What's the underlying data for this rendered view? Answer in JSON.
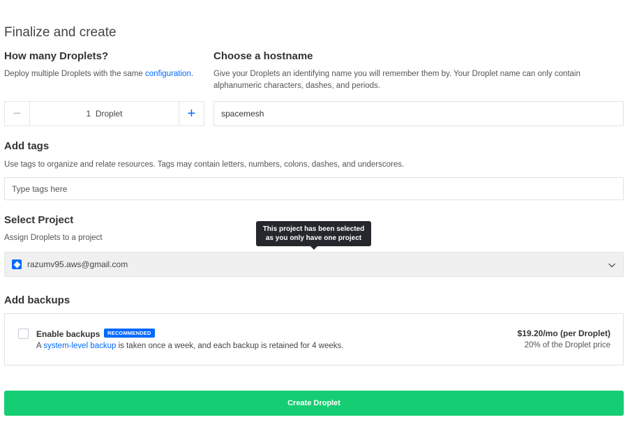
{
  "page": {
    "title": "Finalize and create"
  },
  "droplets": {
    "heading": "How many Droplets?",
    "desc_prefix": "Deploy multiple Droplets with the same ",
    "desc_link": "configuration",
    "desc_suffix": ".",
    "minus_symbol": "−",
    "plus_symbol": "+",
    "count_label": "1  Droplet"
  },
  "hostname": {
    "heading": "Choose a hostname",
    "desc": "Give your Droplets an identifying name you will remember them by. Your Droplet name can only contain alphanumeric characters, dashes, and periods.",
    "value": "spacemesh"
  },
  "tags": {
    "heading": "Add tags",
    "desc": "Use tags to organize and relate resources. Tags may contain letters, numbers, colons, dashes, and underscores.",
    "placeholder": "Type tags here"
  },
  "project": {
    "heading": "Select Project",
    "desc": "Assign Droplets to a project",
    "selected": "razumv95.aws@gmail.com",
    "tooltip_line1": "This project has been selected",
    "tooltip_line2": "as you only have one project"
  },
  "backups": {
    "heading": "Add backups",
    "label": "Enable backups",
    "badge": "RECOMMENDED",
    "desc_prefix": "A ",
    "desc_link": "system-level backup",
    "desc_suffix": " is taken once a week, and each backup is retained for 4 weeks.",
    "price": "$19.20/mo (per Droplet)",
    "price_sub": "20% of the Droplet price"
  },
  "create_button": "Create Droplet",
  "colors": {
    "accent": "#0069ff",
    "create": "#15cd72",
    "tooltip": "#24272b"
  }
}
